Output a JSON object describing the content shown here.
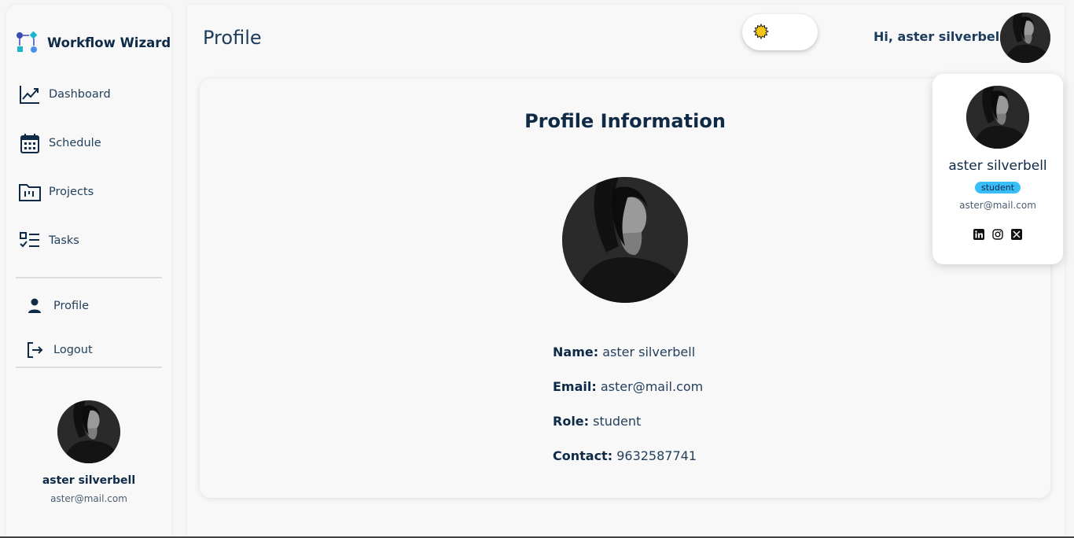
{
  "brand": {
    "name": "Workflow Wizard",
    "icon": "workflow-logo-icon"
  },
  "sidebar": {
    "items": [
      {
        "label": "Dashboard",
        "icon": "chart-line-icon"
      },
      {
        "label": "Schedule",
        "icon": "calendar-icon"
      },
      {
        "label": "Projects",
        "icon": "folder-kanban-icon"
      },
      {
        "label": "Tasks",
        "icon": "checklist-icon"
      }
    ],
    "secondary": [
      {
        "label": "Profile",
        "icon": "person-icon"
      },
      {
        "label": "Logout",
        "icon": "logout-icon"
      }
    ],
    "user": {
      "name": "aster silverbell",
      "email": "aster@mail.com"
    }
  },
  "header": {
    "title": "Profile",
    "greeting": "Hi, aster silverbell",
    "theme_icon": "sun-icon"
  },
  "profile": {
    "title": "Profile Information",
    "fields": [
      {
        "label": "Name:",
        "value": "aster silverbell"
      },
      {
        "label": "Email:",
        "value": "aster@mail.com"
      },
      {
        "label": "Role:",
        "value": "student"
      },
      {
        "label": "Contact:",
        "value": "9632587741"
      }
    ]
  },
  "popup": {
    "name": "aster silverbell",
    "role": "student",
    "email": "aster@mail.com",
    "socials": [
      "linkedin-icon",
      "instagram-icon",
      "x-icon"
    ]
  },
  "colors": {
    "accent": "#38bdf8",
    "text_dark": "#0e2a47",
    "sun": "#f5c518"
  }
}
